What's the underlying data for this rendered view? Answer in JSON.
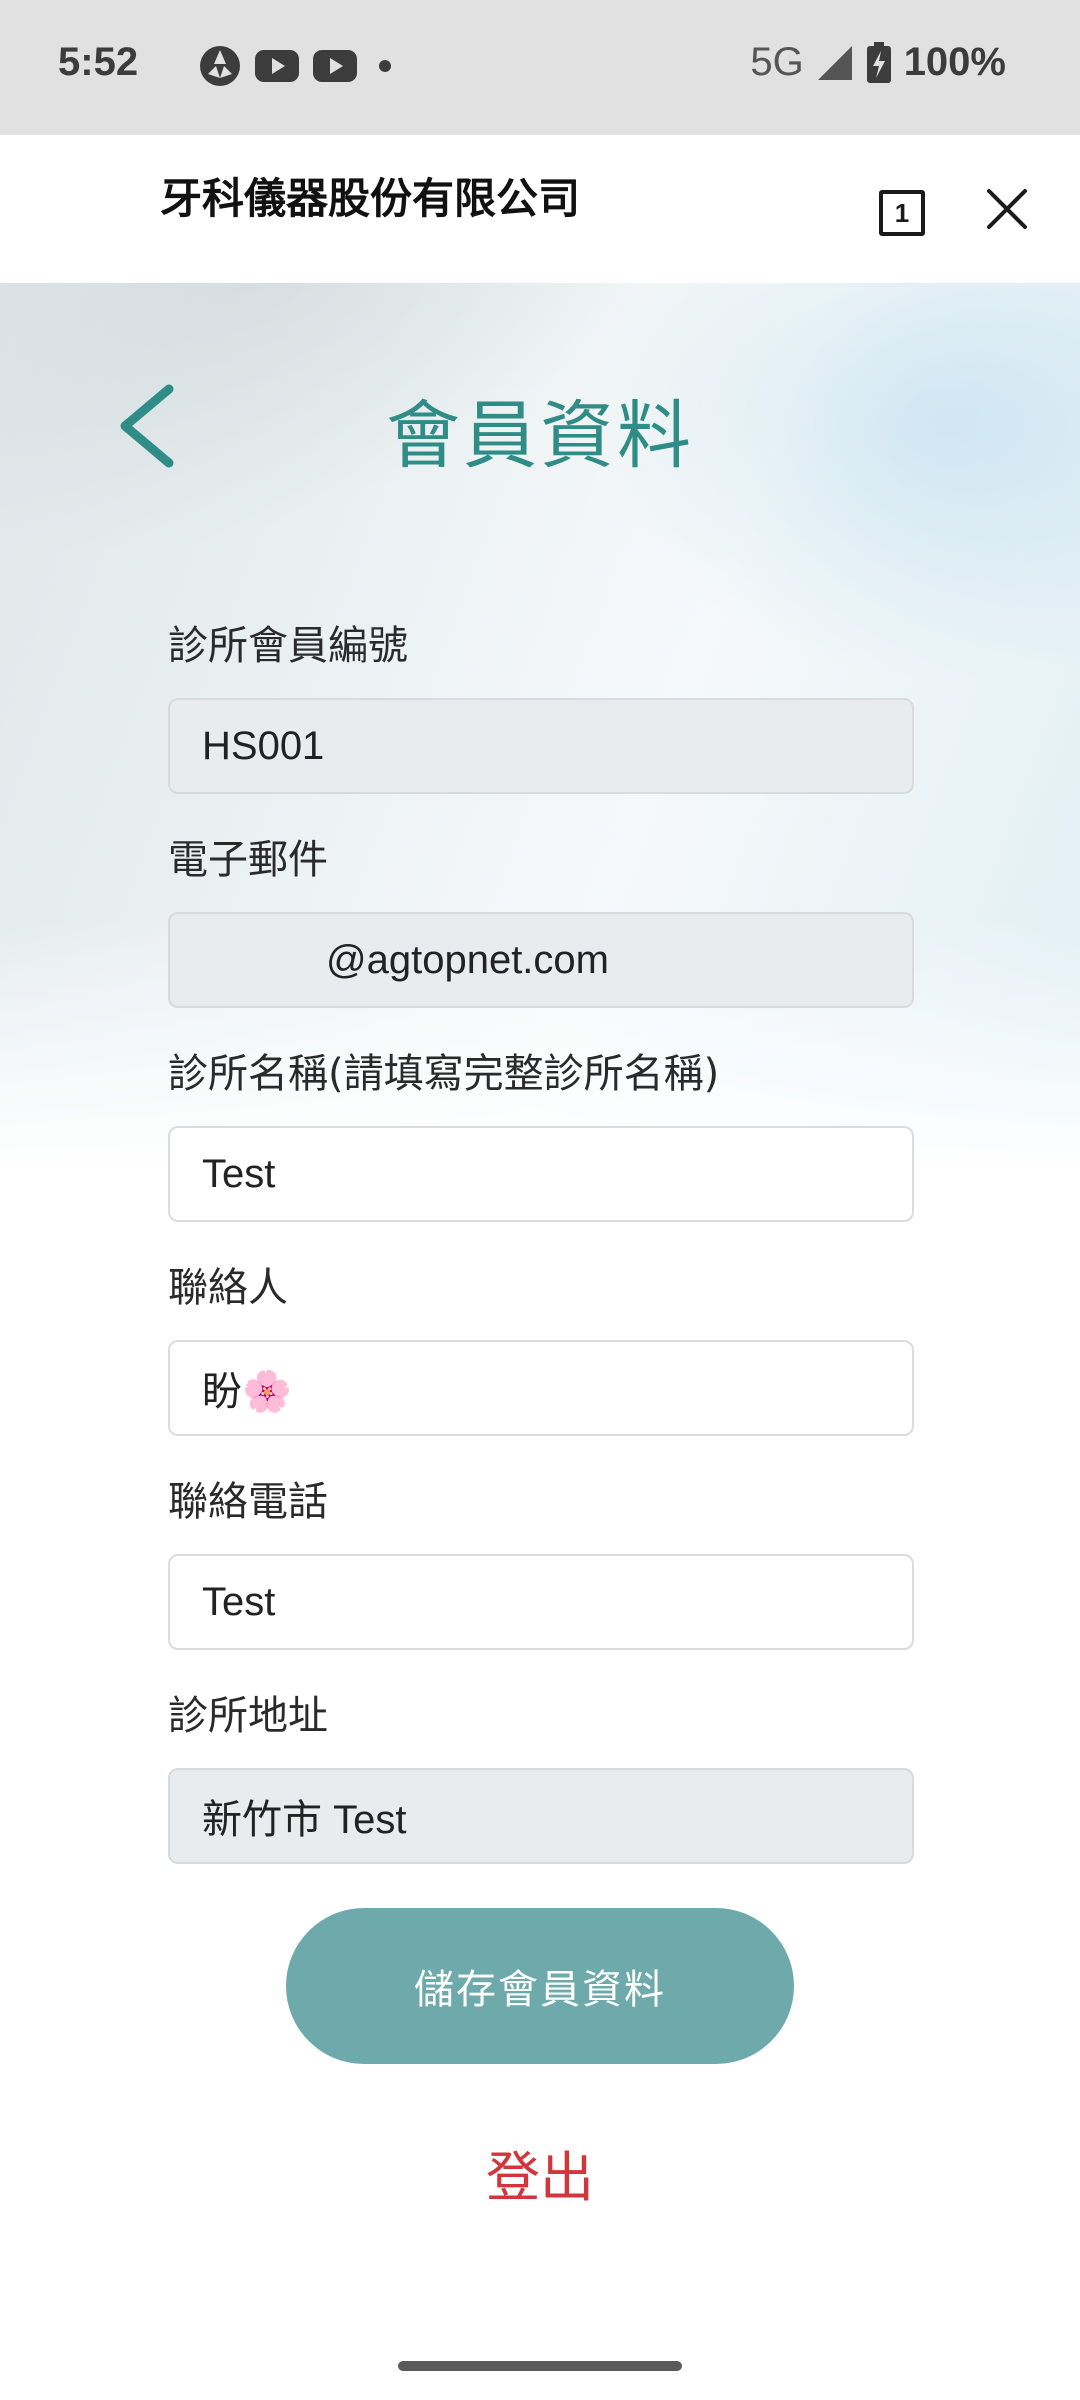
{
  "status_bar": {
    "time": "5:52",
    "network": "5G",
    "battery": "100%",
    "icons": [
      "app-notification-icon",
      "youtube-icon",
      "youtube-icon",
      "more-dot-icon",
      "signal-icon",
      "battery-charging-icon"
    ]
  },
  "header": {
    "company": "牙科儀器股份有限公司",
    "tab_count": "1"
  },
  "page": {
    "title": "會員資料"
  },
  "form": {
    "member_id": {
      "label": "診所會員編號",
      "value": "HS001"
    },
    "email": {
      "label": "電子郵件",
      "value": "@agtopnet.com"
    },
    "clinic_name": {
      "label": "診所名稱(請填寫完整診所名稱)",
      "value": "Test"
    },
    "contact": {
      "label": "聯絡人",
      "value": "盼🌸"
    },
    "phone": {
      "label": "聯絡電話",
      "value": "Test"
    },
    "address": {
      "label": "診所地址",
      "value": "新竹市 Test"
    }
  },
  "actions": {
    "save_label": "儲存會員資料",
    "logout_label": "登出"
  },
  "colors": {
    "accent": "#2f8c86",
    "button": "#6eaaab",
    "logout": "#d1363c",
    "readonly_bg": "#e9ebee"
  }
}
